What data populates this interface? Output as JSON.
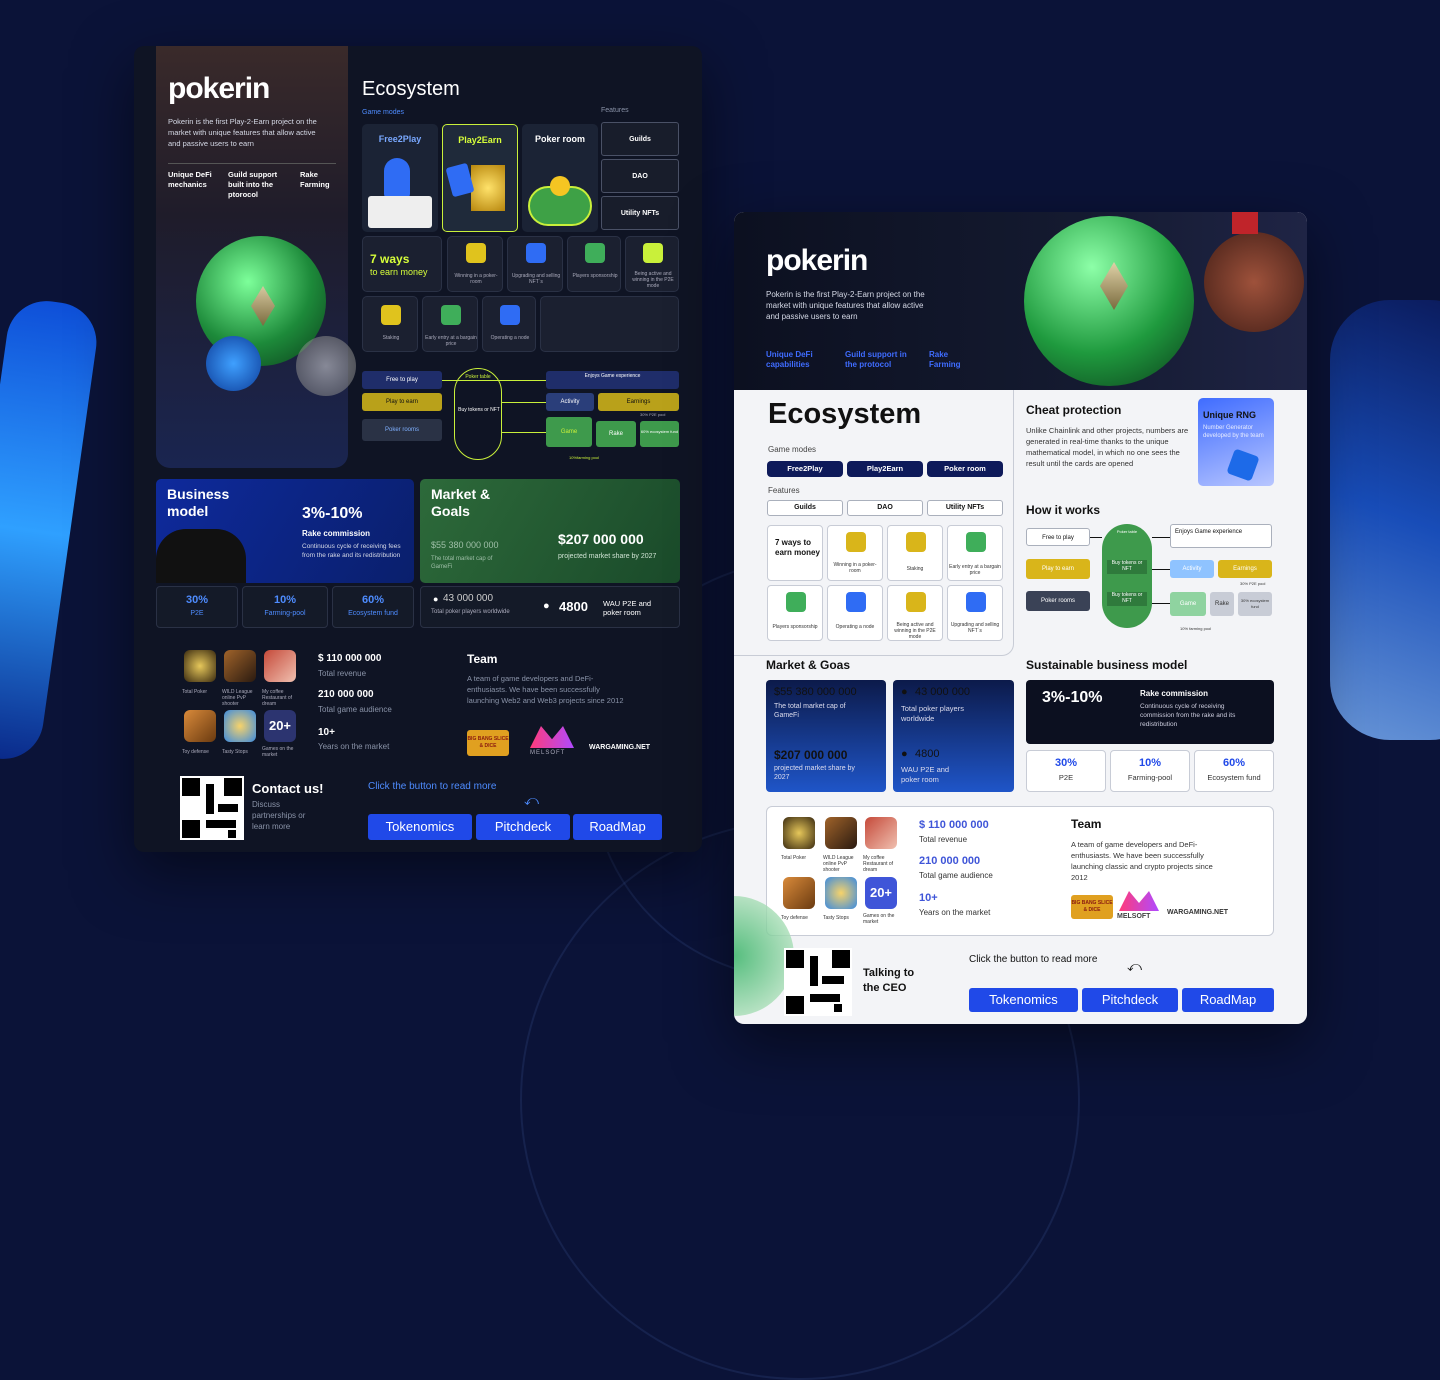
{
  "dark": {
    "logo": "pokerin",
    "intro": "Pokerin is the first Play-2-Earn project on the market with unique features that allow active and passive users to earn",
    "caps": [
      "Unique DeFi mechanics",
      "Guild support built into the ptorocol",
      "Rake Farming"
    ],
    "ecosystem": "Ecosystem",
    "game_modes_label": "Game modes",
    "features_label": "Features",
    "modes": [
      "Free2Play",
      "Play2Earn",
      "Poker room"
    ],
    "features": [
      "Guilds",
      "DAO",
      "Utility NFTs"
    ],
    "ways_title": "7 ways",
    "ways_sub": "to earn money",
    "ways": [
      "Winning in a poker-room",
      "Upgrading and selling NFT`s",
      "Players sponsorship",
      "Being active and winning in the P2E mode",
      "Staking",
      "Early entry at a bargain price",
      "Operating a node"
    ],
    "flow": {
      "left": [
        "Free to play",
        "Play to earn",
        "Poker rooms"
      ],
      "table": "Poker table",
      "buy": "Buy tokens or NFT",
      "staking": "Staking",
      "enjoy": "Enjoys Game experience",
      "activity": "Activity",
      "earnings": "Earnings",
      "game": "Game",
      "rake": "Rake",
      "p2e_pool": "30% P2E pool",
      "eco_fund": "60% ecosystem fund",
      "farming_pool": "10%farming pool"
    },
    "business": {
      "title": "Business model",
      "pct": "3%-10%",
      "rake": "Rake commission",
      "desc": "Continuous cycle of receiving fees from the rake and its redistribution"
    },
    "market": {
      "title": "Market & Goals",
      "cap_value": "$55 380 000 000",
      "cap_label": "The total market cap of GameFi",
      "proj_value": "$207 000 000",
      "proj_label": "projected market share by 2027",
      "players_value": "43 000 000",
      "players_label": "Total poker players worldwide",
      "wau_value": "4800",
      "wau_label": "WAU P2E and poker room"
    },
    "splits": [
      {
        "pct": "30%",
        "label": "P2E"
      },
      {
        "pct": "10%",
        "label": "Farming-pool"
      },
      {
        "pct": "60%",
        "label": "Ecosystem fund"
      }
    ],
    "apps": [
      "Total Poker",
      "WILD League online PvP shooter",
      "My coffee Restaurant of dream",
      "Toy defense",
      "Tasty Stops",
      "Games on the market"
    ],
    "apps_more": "20+",
    "revenue_value": "$ 110 000 000",
    "revenue_label": "Total revenue",
    "audience_value": "210 000 000",
    "audience_label": "Total game audience",
    "years_value": "10+",
    "years_label": "Years on the market",
    "team_title": "Team",
    "team_text": "A team of game developers and DeFi-enthusiasts. We have been successfully launching Web2 and Web3 projects since 2012",
    "partners": [
      "BIG BANG SLICE & DICE",
      "MELSOFT",
      "WARGAMING.NET"
    ],
    "contact_title": "Contact us!",
    "contact_text": "Discuss partnerships or learn more",
    "read_more": "Click the button to read more",
    "buttons": [
      "Tokenomics",
      "Pitchdeck",
      "RoadMap"
    ]
  },
  "light": {
    "logo": "pokerin",
    "intro": "Pokerin is the first Play-2-Earn project on the market with unique features that allow active and passive users to earn",
    "caps": [
      "Unique DeFi capabilities",
      "Guild support in the protocol",
      "Rake Farming"
    ],
    "ecosystem": "Ecosystem",
    "game_modes_label": "Game modes",
    "features_label": "Features",
    "modes": [
      "Free2Play",
      "Play2Earn",
      "Poker room"
    ],
    "features": [
      "Guilds",
      "DAO",
      "Utility NFTs"
    ],
    "ways_title": "7 ways to earn money",
    "ways": [
      "Winning in a poker-room",
      "Staking",
      "Early entry at a bargain price",
      "Players sponsorship",
      "Operating a node",
      "Being active and winning in the P2E mode",
      "Upgrading and selling NFT`s"
    ],
    "cheat_title": "Cheat protection",
    "cheat_text": "Unlike Chainlink and other projects, numbers are generated in real-time thanks to the unique mathematical model, in which no one sees the result until the cards are opened",
    "rng_title": "Unique RNG",
    "rng_text": "Number Generator developed by the team",
    "how_title": "How it works",
    "flow": {
      "left": [
        "Free to play",
        "Play to earn",
        "Poker rooms"
      ],
      "table": "Poker table",
      "buy": "Buy tokens or NFT",
      "staking": "Staking",
      "enjoy": "Enjoys Game experience",
      "activity": "Activity",
      "earnings": "Earnings",
      "game": "Game",
      "rake": "Rake",
      "p2e_pool": "30% P2E pool",
      "eco_fund": "30% ecosystem fund",
      "farming_pool": "10% farming pool"
    },
    "market_title": "Market & Goas",
    "cap_value": "$55 380 000 000",
    "cap_label": "The total market cap of GameFi",
    "proj_value": "$207 000 000",
    "proj_label": "projected market share by 2027",
    "players_value": "43 000 000",
    "players_label": "Total poker players worldwide",
    "wau_value": "4800",
    "wau_label": "WAU P2E and poker room",
    "biz_title": "Sustainable business model",
    "biz_pct": "3%-10%",
    "biz_rake": "Rake commission",
    "biz_desc": "Continuous cycle of receiving commission from the rake and its redistribution",
    "splits": [
      {
        "pct": "30%",
        "label": "P2E"
      },
      {
        "pct": "10%",
        "label": "Farming-pool"
      },
      {
        "pct": "60%",
        "label": "Ecosystem fund"
      }
    ],
    "apps": [
      "Total Poker",
      "WILD League online PvP shooter",
      "My coffee Restaurant of dream",
      "Toy defense",
      "Tasty Stops",
      "Games on the market"
    ],
    "apps_more": "20+",
    "revenue_value": "$ 110 000 000",
    "revenue_label": "Total revenue",
    "audience_value": "210 000 000",
    "audience_label": "Total game audience",
    "years_value": "10+",
    "years_label": "Years on the market",
    "team_title": "Team",
    "team_text": "A team of game developers and DeFi-enthusiasts. We have been successfully launching classic and crypto projects since 2012",
    "partners": [
      "BIG BANG SLICE & DICE",
      "MELSOFT",
      "WARGAMING.NET"
    ],
    "talk": "Talking to the CEO",
    "read_more": "Click the button to read more",
    "buttons": [
      "Tokenomics",
      "Pitchdeck",
      "RoadMap"
    ]
  }
}
